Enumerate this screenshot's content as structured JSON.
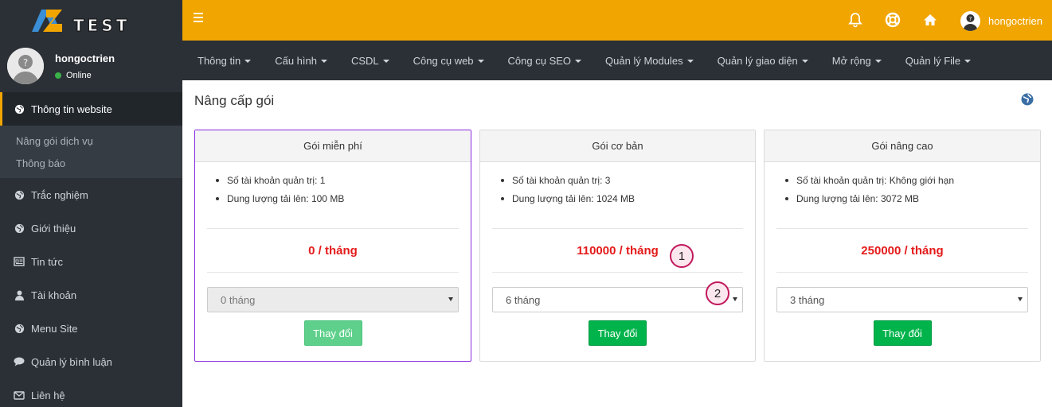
{
  "colors": {
    "brand": "#f1a500",
    "sidebar": "#2b3036",
    "price": "#e51a1a",
    "button": "#00b34b"
  },
  "logo": {
    "text": "AZTEST"
  },
  "topbar": {
    "username": "hongoctrien"
  },
  "sidebar": {
    "user": {
      "name": "hongoctrien",
      "status": "Online"
    },
    "active_item": {
      "label": "Thông tin website",
      "icon": "globe-icon"
    },
    "sub_items": [
      "Nâng gói dịch vụ",
      "Thông báo"
    ],
    "items": [
      {
        "label": "Trắc nghiệm",
        "icon": "globe-icon"
      },
      {
        "label": "Giới thiệu",
        "icon": "globe-icon"
      },
      {
        "label": "Tin tức",
        "icon": "newspaper-icon"
      },
      {
        "label": "Tài khoản",
        "icon": "user-icon"
      },
      {
        "label": "Menu Site",
        "icon": "globe-icon"
      },
      {
        "label": "Quản lý bình luận",
        "icon": "comment-icon"
      },
      {
        "label": "Liên hệ",
        "icon": "envelope-icon"
      }
    ]
  },
  "menu": [
    "Thông tin",
    "Cấu hình",
    "CSDL",
    "Công cụ web",
    "Công cụ SEO",
    "Quản lý Modules",
    "Quản lý giao diện",
    "Mở rộng",
    "Quản lý File"
  ],
  "page": {
    "title": "Nâng cấp gói"
  },
  "plans": [
    {
      "name": "Gói miễn phí",
      "features": [
        "Số tài khoản quản trị: 1",
        "Dung lượng tải lên: 100 MB"
      ],
      "price": "0 / tháng",
      "duration": "0 tháng",
      "button": "Thay đổi"
    },
    {
      "name": "Gói cơ bản",
      "features": [
        "Số tài khoản quản trị: 3",
        "Dung lượng tải lên: 1024 MB"
      ],
      "price": "110000 / tháng",
      "duration": "6 tháng",
      "button": "Thay đổi"
    },
    {
      "name": "Gói nâng cao",
      "features": [
        "Số tài khoản quản trị: Không giới hạn",
        "Dung lượng tải lên: 3072 MB"
      ],
      "price": "250000 / tháng",
      "duration": "3 tháng",
      "button": "Thay đổi"
    }
  ],
  "markers": [
    "1",
    "2"
  ]
}
